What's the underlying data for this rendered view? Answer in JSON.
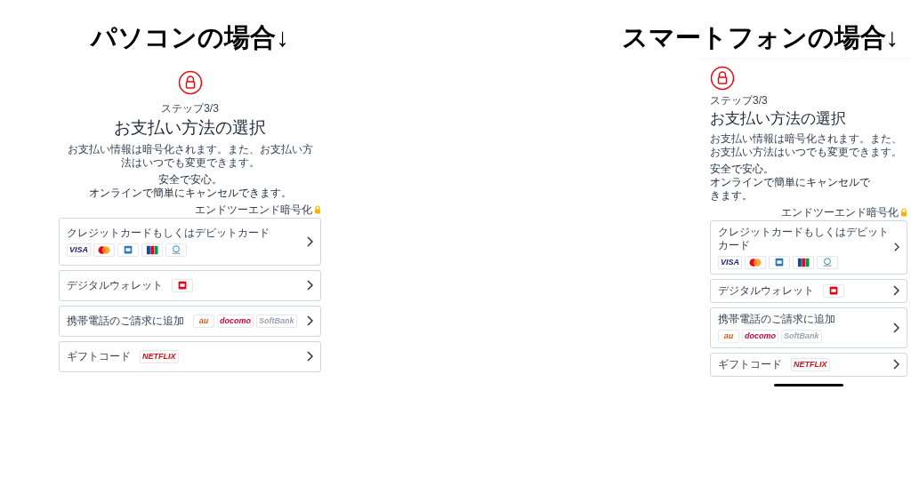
{
  "views": [
    {
      "kind": "desktop",
      "heading": "パソコンの場合↓",
      "step": "ステップ3/3",
      "title": "お支払い方法の選択",
      "description": "お支払い情報は暗号化されます。また、お支払い方法はいつでも変更できます。",
      "reassurance": [
        "安全で安心。",
        "オンラインで簡単にキャンセルできます。"
      ],
      "encryption_note": "エンドツーエンド暗号化",
      "home_indicator": false,
      "options": [
        {
          "label": "クレジットカードもしくはデビットカード",
          "logos": [
            {
              "kind": "wordmark",
              "text": "VISA",
              "color": "#1a1f71"
            },
            {
              "kind": "circles"
            },
            {
              "kind": "square",
              "color": "#2e77bc"
            },
            {
              "kind": "stripes"
            },
            {
              "kind": "globe"
            }
          ]
        },
        {
          "label": "デジタルウォレット",
          "logos": [
            {
              "kind": "square",
              "color": "#e60012"
            }
          ]
        },
        {
          "label": "携帯電話のご請求に追加",
          "logos": [
            {
              "kind": "wordmark",
              "text": "au",
              "color": "#eb5505"
            },
            {
              "kind": "wordmark",
              "text": "docomo",
              "color": "#cc0033"
            },
            {
              "kind": "wordmark",
              "text": "SoftBank",
              "color": "#9ca3af"
            }
          ]
        },
        {
          "label": "ギフトコード",
          "logos": [
            {
              "kind": "wordmark",
              "text": "NETFLIX",
              "color": "#e50914"
            }
          ]
        }
      ]
    },
    {
      "kind": "phone",
      "heading": "スマートフォンの場合↓",
      "step": "ステップ3/3",
      "title": "お支払い方法の選択",
      "description": "お支払い情報は暗号化されます。また、お支払い方法はいつでも変更できます。",
      "reassurance": [
        "安全で安心。",
        "オンラインで簡単にキャンセルできます。"
      ],
      "encryption_note": "エンドツーエンド暗号化",
      "home_indicator": true,
      "options": [
        {
          "label": "クレジットカードもしくはデビットカード",
          "logos": [
            {
              "kind": "wordmark",
              "text": "VISA",
              "color": "#1a1f71"
            },
            {
              "kind": "circles"
            },
            {
              "kind": "square",
              "color": "#2e77bc"
            },
            {
              "kind": "stripes"
            },
            {
              "kind": "globe"
            }
          ]
        },
        {
          "label": "デジタルウォレット",
          "logos": [
            {
              "kind": "square",
              "color": "#e60012"
            }
          ]
        },
        {
          "label": "携帯電話のご請求に追加",
          "logos": [
            {
              "kind": "wordmark",
              "text": "au",
              "color": "#eb5505"
            },
            {
              "kind": "wordmark",
              "text": "docomo",
              "color": "#cc0033"
            },
            {
              "kind": "wordmark",
              "text": "SoftBank",
              "color": "#9ca3af"
            }
          ]
        },
        {
          "label": "ギフトコード",
          "logos": [
            {
              "kind": "wordmark",
              "text": "NETFLIX",
              "color": "#e50914"
            }
          ]
        }
      ]
    }
  ]
}
